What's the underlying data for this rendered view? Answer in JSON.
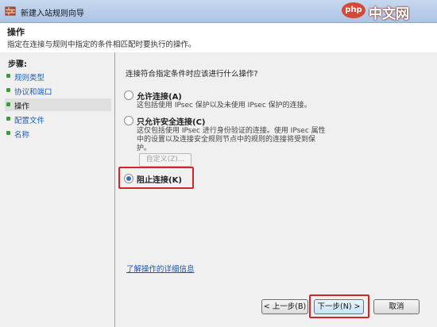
{
  "window": {
    "title": "新建入站规则向导",
    "icon": "firewall-icon"
  },
  "watermark": {
    "badge": "php",
    "text": "中文网"
  },
  "header": {
    "title": "操作",
    "subtitle": "指定在连接与规则中指定的条件相匹配时要执行的操作。"
  },
  "steps": {
    "title": "步骤:",
    "items": [
      {
        "label": "规则类型"
      },
      {
        "label": "协议和端口"
      },
      {
        "label": "操作",
        "current": true
      },
      {
        "label": "配置文件"
      },
      {
        "label": "名称"
      }
    ]
  },
  "main": {
    "question": "连接符合指定条件时应该进行什么操作?",
    "options": [
      {
        "label": "允许连接(A)",
        "desc": "这包括使用 IPsec 保护以及未使用 IPsec 保护的连接。",
        "checked": false
      },
      {
        "label": "只允许安全连接(C)",
        "desc": "这仅包括使用 IPsec 进行身份验证的连接。使用 IPsec 属性中的设置以及连接安全规则节点中的规则的连接将受到保护。",
        "checked": false
      },
      {
        "label": "阻止连接(K)",
        "checked": true
      }
    ],
    "customize_label": "自定义(Z)...",
    "learn_more": "了解操作的详细信息"
  },
  "buttons": {
    "back": "< 上一步(B)",
    "next": "下一步(N) >",
    "cancel": "取消"
  },
  "colors": {
    "highlight": "#d0282a",
    "link": "#1f5fb3",
    "titlebar": "#c6d8ef"
  }
}
